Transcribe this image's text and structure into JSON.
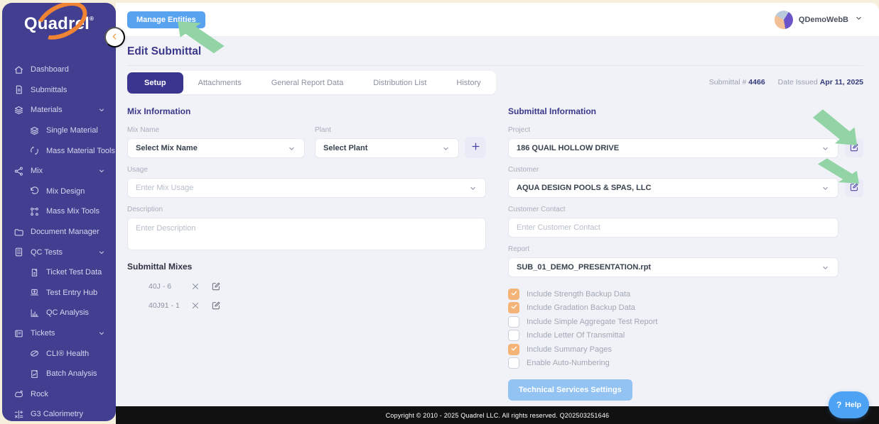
{
  "sidebar": {
    "logo_text": "Quadrel",
    "logo_reg": "®",
    "items": [
      {
        "label": "Dashboard"
      },
      {
        "label": "Submittals"
      },
      {
        "label": "Materials"
      },
      {
        "label": "Single Material"
      },
      {
        "label": "Mass Material Tools"
      },
      {
        "label": "Mix"
      },
      {
        "label": "Mix Design"
      },
      {
        "label": "Mass Mix Tools"
      },
      {
        "label": "Document Manager"
      },
      {
        "label": "QC Tests"
      },
      {
        "label": "Ticket Test Data"
      },
      {
        "label": "Test Entry Hub"
      },
      {
        "label": "QC Analysis"
      },
      {
        "label": "Tickets"
      },
      {
        "label": "CLI® Health"
      },
      {
        "label": "Batch Analysis"
      },
      {
        "label": "Rock"
      },
      {
        "label": "G3 Calorimetry"
      }
    ]
  },
  "header": {
    "manage_entities_label": "Manage Entities",
    "user_name": "QDemoWebB"
  },
  "page": {
    "title": "Edit Submittal",
    "tabs": [
      "Setup",
      "Attachments",
      "General Report Data",
      "Distribution List",
      "History"
    ],
    "active_tab": "Setup",
    "submittal_number_label": "Submittal #",
    "submittal_number": "4466",
    "date_issued_label": "Date Issued",
    "date_issued": "Apr 11, 2025"
  },
  "mix_information": {
    "heading": "Mix Information",
    "mix_name_label": "Mix Name",
    "mix_name_value": "Select Mix Name",
    "plant_label": "Plant",
    "plant_value": "Select Plant",
    "usage_label": "Usage",
    "usage_placeholder": "Enter Mix Usage",
    "description_label": "Description",
    "description_placeholder": "Enter Description"
  },
  "submittal_mixes": {
    "heading": "Submittal Mixes",
    "mixes": [
      {
        "name": "40J - 6"
      },
      {
        "name": "40J91 - 1"
      }
    ]
  },
  "submittal_information": {
    "heading": "Submittal Information",
    "project_label": "Project",
    "project_value": "186 QUAIL HOLLOW DRIVE",
    "customer_label": "Customer",
    "customer_value": "AQUA DESIGN POOLS & SPAS, LLC",
    "customer_contact_label": "Customer Contact",
    "customer_contact_placeholder": "Enter Customer Contact",
    "report_label": "Report",
    "report_value": "SUB_01_DEMO_PRESENTATION.rpt",
    "checkboxes": [
      {
        "label": "Include Strength Backup Data",
        "checked": true
      },
      {
        "label": "Include Gradation Backup Data",
        "checked": true
      },
      {
        "label": "Include Simple Aggregate Test Report",
        "checked": false
      },
      {
        "label": "Include Letter Of Transmittal",
        "checked": false
      },
      {
        "label": "Include Summary Pages",
        "checked": true
      },
      {
        "label": "Enable Auto-Numbering",
        "checked": false
      }
    ],
    "technical_services_button": "Technical Services Settings"
  },
  "footer": {
    "copyright": "Copyright © 2010 - 2025 Quadrel LLC. All rights reserved. Q202503251646",
    "help_icon": "?",
    "help_label": "Help"
  },
  "colors": {
    "sidebar_bg": "#423F90",
    "accent_indigo": "#3A3690",
    "accent_blue": "#58A3F0",
    "checkbox_orange": "#F4B377",
    "arrow_green": "#93D4A6",
    "cream_bg": "#F6EFDC",
    "content_bg": "#F0F2F7",
    "logo_swoosh_orange": "#EE8434"
  }
}
